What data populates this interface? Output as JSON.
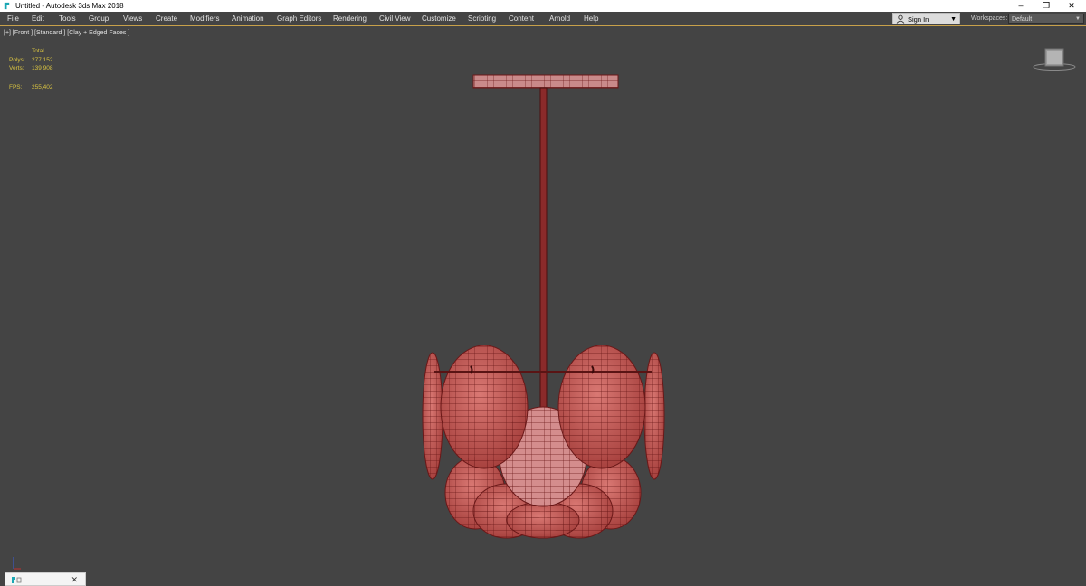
{
  "window": {
    "title": "Untitled - Autodesk 3ds Max 2018"
  },
  "menubar": {
    "items": [
      "File",
      "Edit",
      "Tools",
      "Group",
      "Views",
      "Create",
      "Modifiers",
      "Animation",
      "Graph Editors",
      "Rendering",
      "Civil View",
      "Customize",
      "Scripting",
      "Content",
      "Arnold",
      "Help"
    ]
  },
  "account": {
    "sign_in_label": "Sign In"
  },
  "workspaces": {
    "label": "Workspaces:",
    "value": "Default"
  },
  "viewport": {
    "label": "[+] [Front ] [Standard ] [Clay + Edged Faces ]",
    "stats": {
      "header": "Total",
      "polys_label": "Polys:",
      "polys_value": "277 152",
      "verts_label": "Verts:",
      "verts_value": "139 908",
      "fps_label": "FPS:",
      "fps_value": "255,402"
    }
  },
  "colors": {
    "background": "#444444",
    "accent": "#c8a14a",
    "stats_text": "#d9c341",
    "mesh_fill": "#c25a58",
    "mesh_wire": "#6a1818"
  },
  "icons": [
    "app-icon",
    "minimize-icon",
    "restore-icon",
    "close-icon",
    "person-icon",
    "dropdown-caret-icon",
    "viewcube-icon",
    "axis-tripod-icon",
    "close-tab-icon"
  ]
}
